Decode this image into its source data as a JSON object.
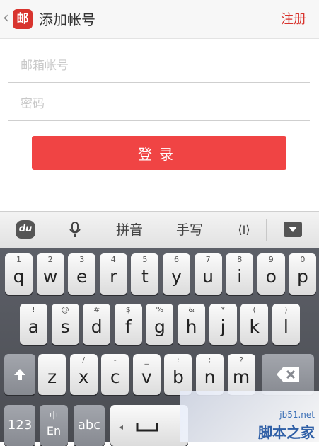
{
  "header": {
    "back_glyph": "‹",
    "app_icon_text": "邮",
    "title": "添加帐号",
    "register_label": "注册"
  },
  "form": {
    "email_placeholder": "邮箱帐号",
    "password_placeholder": "密码",
    "login_label": "登录"
  },
  "keyboard_toolbar": {
    "logo_text": "du",
    "pinyin_label": "拼音",
    "handwrite_label": "手写",
    "cursor_glyph": "⟨I⟩"
  },
  "keys": {
    "row1": [
      {
        "sub": "1",
        "main": "q"
      },
      {
        "sub": "2",
        "main": "w"
      },
      {
        "sub": "3",
        "main": "e"
      },
      {
        "sub": "4",
        "main": "r"
      },
      {
        "sub": "5",
        "main": "t"
      },
      {
        "sub": "6",
        "main": "y"
      },
      {
        "sub": "7",
        "main": "u"
      },
      {
        "sub": "8",
        "main": "i"
      },
      {
        "sub": "9",
        "main": "o"
      },
      {
        "sub": "0",
        "main": "p"
      }
    ],
    "row2": [
      {
        "sub": "!",
        "main": "a"
      },
      {
        "sub": "@",
        "main": "s"
      },
      {
        "sub": "#",
        "main": "d"
      },
      {
        "sub": "$",
        "main": "f"
      },
      {
        "sub": "%",
        "main": "g"
      },
      {
        "sub": "&",
        "main": "h"
      },
      {
        "sub": "*",
        "main": "j"
      },
      {
        "sub": "(",
        "main": "k"
      },
      {
        "sub": ")",
        "main": "l"
      }
    ],
    "row3": [
      {
        "sub": "'",
        "main": "z"
      },
      {
        "sub": "/",
        "main": "x"
      },
      {
        "sub": "-",
        "main": "c"
      },
      {
        "sub": "_",
        "main": "v"
      },
      {
        "sub": ":",
        "main": "b"
      },
      {
        "sub": ";",
        "main": "n"
      },
      {
        "sub": "?",
        "main": "m"
      }
    ],
    "num_label": "123",
    "lang_top": "中",
    "lang_bottom": "En",
    "abc_label": "abc"
  },
  "watermark": {
    "url": "jb51.net",
    "name": "脚本之家"
  },
  "colors": {
    "accent": "#d8342e",
    "login_button": "#f04444"
  }
}
